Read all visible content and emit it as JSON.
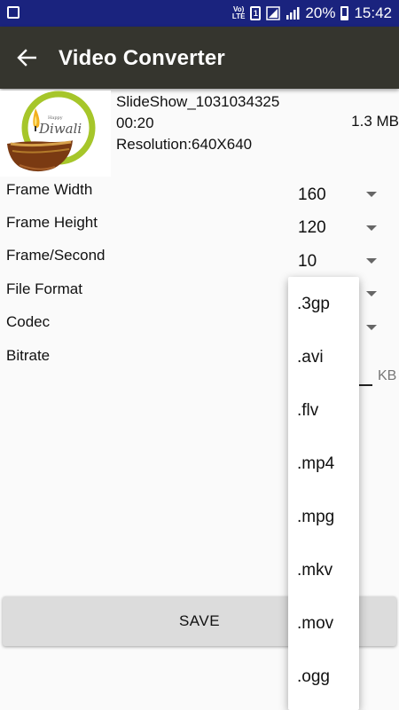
{
  "status_bar": {
    "volte": "Vo) LTE",
    "sim": "1",
    "battery": "20%",
    "time": "15:42",
    "bg_color": "#1a237e"
  },
  "app_bar": {
    "title": "Video Converter",
    "back_icon": "arrow-left-icon",
    "bg_color": "#35352e"
  },
  "video": {
    "thumbnail_text": "Diwali",
    "thumbnail_small_text": "Happy",
    "name": "SlideShow_1031034325",
    "duration": "00:20",
    "size": "1.3 MB",
    "resolution": "Resolution:640X640"
  },
  "settings": [
    {
      "label": "Frame Width",
      "value": "160"
    },
    {
      "label": "Frame Height",
      "value": "120"
    },
    {
      "label": "Frame/Second",
      "value": "10"
    },
    {
      "label": "File Format",
      "value": ""
    },
    {
      "label": "Codec",
      "value": ""
    },
    {
      "label": "Bitrate",
      "value": ""
    }
  ],
  "bitrate_unit": "KB",
  "save_label": "SAVE",
  "format_options": [
    ".3gp",
    ".avi",
    ".flv",
    ".mp4",
    ".mpg",
    ".mkv",
    ".mov",
    ".ogg"
  ]
}
